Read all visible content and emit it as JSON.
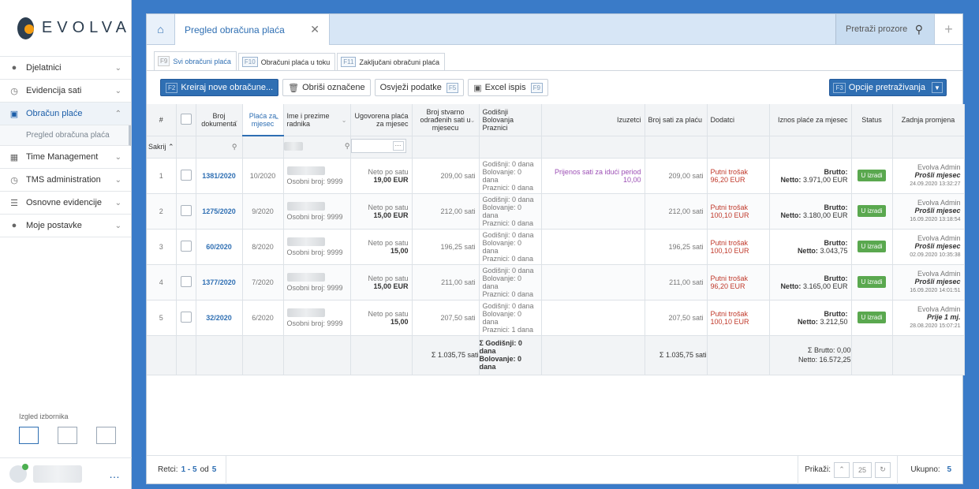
{
  "brand": {
    "name": "EVOLVA"
  },
  "sidebar": {
    "items": [
      {
        "label": "Djelatnici",
        "icon": "person-icon"
      },
      {
        "label": "Evidencija sati",
        "icon": "clock-icon"
      },
      {
        "label": "Obračun plaće",
        "icon": "money-icon",
        "active": true
      },
      {
        "label": "Time Management",
        "icon": "calendar-icon"
      },
      {
        "label": "TMS administration",
        "icon": "clock-icon"
      },
      {
        "label": "Osnovne evidencije",
        "icon": "list-icon"
      },
      {
        "label": "Moje postavke",
        "icon": "person-icon"
      }
    ],
    "subitem": "Pregled obračuna plaća",
    "layout_label": "Izgled izbornika"
  },
  "tabs": {
    "page_title": "Pregled obračuna plaća",
    "search_windows": "Pretraži prozore"
  },
  "subtabs": [
    {
      "key": "F9",
      "label": "Svi obračuni plaća"
    },
    {
      "key": "F10",
      "label": "Obračuni plaća u toku"
    },
    {
      "key": "F11",
      "label": "Zaključani obračuni plaća"
    }
  ],
  "toolbar": {
    "create_key": "F2",
    "create_label": "Kreiraj nove obračune...",
    "delete_label": "Obriši označene",
    "refresh_label": "Osvježi podatke",
    "refresh_key": "F5",
    "excel_label": "Excel ispis",
    "excel_key": "F9",
    "options_key": "F3",
    "options_label": "Opcije pretraživanja"
  },
  "columns": {
    "num": "#",
    "doc": "Broj dokumenta",
    "month": "Plaća za mjesec",
    "name": "Ime i prezime radnika",
    "salary": "Ugovorena plaća za mjesec",
    "hours": "Broj stvarno odrađenih sati u mjesecu",
    "leave": "Godišnji Bolovanja Praznici",
    "exceptions": "Izuzetci",
    "payhours": "Broj sati za plaću",
    "extras": "Dodatci",
    "amount": "Iznos plaće za mjesec",
    "status": "Status",
    "last": "Zadnja promjena",
    "hide": "Sakrij"
  },
  "rows": [
    {
      "n": "1",
      "doc": "1381/2020",
      "month": "10/2020",
      "person_no": "Osobni broj: 9999",
      "rate_label": "Neto po satu",
      "rate": "19,00 EUR",
      "hours": "209,00  sati",
      "leave": [
        "Godišnji: 0 dana",
        "Bolovanje: 0 dana",
        "Praznici: 0 dana"
      ],
      "exception": "Prijenos sati za idući period 10,00",
      "payhours": "209,00 sati",
      "extra": "Putni trošak  96,20 EUR",
      "brutto": "Brutto:",
      "netto_label": "Netto:",
      "netto": "3.971,00 EUR",
      "status": "U izradi",
      "by": "Evolva Admin",
      "period": "Prošli mjesec",
      "date": "24.09.2020 13:32:27"
    },
    {
      "n": "2",
      "doc": "1275/2020",
      "month": "9/2020",
      "person_no": "Osobni broj: 9999",
      "rate_label": "Neto po satu",
      "rate": "15,00 EUR",
      "hours": "212,00  sati",
      "leave": [
        "Godišnji: 0 dana",
        "Bolovanje: 0 dana",
        "Praznici: 0 dana"
      ],
      "exception": "",
      "payhours": "212,00 sati",
      "extra": "Putni trošak 100,10 EUR",
      "brutto": "Brutto:",
      "netto_label": "Netto:",
      "netto": "3.180,00 EUR",
      "status": "U izradi",
      "by": "Evolva Admin",
      "period": "Prošli mjesec",
      "date": "16.09.2020 13:18:54"
    },
    {
      "n": "3",
      "doc": "60/2020",
      "month": "8/2020",
      "person_no": "Osobni broj: 9999",
      "rate_label": "Neto po satu",
      "rate": "15,00",
      "hours": "196,25  sati",
      "leave": [
        "Godišnji: 0 dana",
        "Bolovanje: 0 dana",
        "Praznici: 0 dana"
      ],
      "exception": "",
      "payhours": "196,25 sati",
      "extra": "Putni trošak 100,10 EUR",
      "brutto": "Brutto:",
      "netto_label": "Netto:",
      "netto": "3.043,75",
      "status": "U izradi",
      "by": "Evolva Admin",
      "period": "Prošli mjesec",
      "date": "02.09.2020 10:35:38"
    },
    {
      "n": "4",
      "doc": "1377/2020",
      "month": "7/2020",
      "person_no": "Osobni broj: 9999",
      "rate_label": "Neto po satu",
      "rate": "15,00 EUR",
      "hours": "211,00  sati",
      "leave": [
        "Godišnji: 0 dana",
        "Bolovanje: 0 dana",
        "Praznici: 0 dana"
      ],
      "exception": "",
      "payhours": "211,00 sati",
      "extra": "Putni trošak  96,20 EUR",
      "brutto": "Brutto:",
      "netto_label": "Netto:",
      "netto": "3.165,00 EUR",
      "status": "U izradi",
      "by": "Evolva Admin",
      "period": "Prošli mjesec",
      "date": "16.09.2020 14:01:51"
    },
    {
      "n": "5",
      "doc": "32/2020",
      "month": "6/2020",
      "person_no": "Osobni broj: 9999",
      "rate_label": "Neto po satu",
      "rate": "15,00",
      "hours": "207,50  sati",
      "leave": [
        "Godišnji: 0 dana",
        "Bolovanje: 0 dana",
        "Praznici: 1 dana"
      ],
      "exception": "",
      "payhours": "207,50 sati",
      "extra": "Putni trošak 100,10 EUR",
      "brutto": "Brutto:",
      "netto_label": "Netto:",
      "netto": "3.212,50",
      "status": "U izradi",
      "by": "Evolva Admin",
      "period": "Prije 1 mj.",
      "date": "28.08.2020 15:07:21"
    }
  ],
  "totals": {
    "hours": "Σ 1.035,75  sati",
    "leave": [
      "Σ Godišnji: 0",
      "dana",
      "Bolovanje: 0",
      "dana"
    ],
    "payhours": "Σ 1.035,75 sati",
    "brutto": "Σ Brutto: 0,00",
    "netto": "Netto: 16.572,25"
  },
  "footer": {
    "rows_label": "Retci:",
    "range": "1 - 5",
    "of": "od",
    "of_count": "5",
    "show_label": "Prikaži:",
    "page_size": "25",
    "total_label": "Ukupno:",
    "total": "5"
  }
}
